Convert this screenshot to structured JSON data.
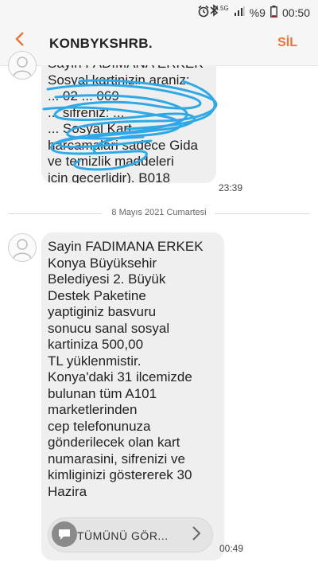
{
  "status": {
    "network": "4.5G",
    "battery": "%9",
    "time": "00:50"
  },
  "header": {
    "title": "KONBYKSHRB.",
    "delete_label": "SİL"
  },
  "messages": [
    {
      "text": "Sayin FADIMANA ERKEK\nSosyal kartinizin araniz:\n... 02 ... 069\n... sifreniz: ...\n... Sosyal Kart\nharcamalari sadece Gida\nve temizlik maddeleri\nicin gecerlidir). B018",
      "time": "23:39"
    },
    {
      "text": "Sayin FADIMANA ERKEK\nKonya Büyüksehir\nBelediyesi 2. Büyük\nDestek Paketine\nyaptiginiz basvuru\nsonucu sanal sosyal\nkartiniza 500,00\nTL yüklenmistir.\nKonya'daki 31 ilcemizde\nbulunan tüm A101\nmarketlerinden\ncep telefonunuza\ngönderilecek olan kart\nnumarasini, sifrenizi ve\nkimliginizi göstererek 30\nHazira",
      "time": "00:49"
    }
  ],
  "date_separator": "8 Mayıs 2021 Cumartesi",
  "read_more_label": "TÜMÜNÜ GÖR...",
  "colors": {
    "accent": "#e8733b",
    "bubble": "#efefef",
    "scribble": "#2ea8e6"
  }
}
